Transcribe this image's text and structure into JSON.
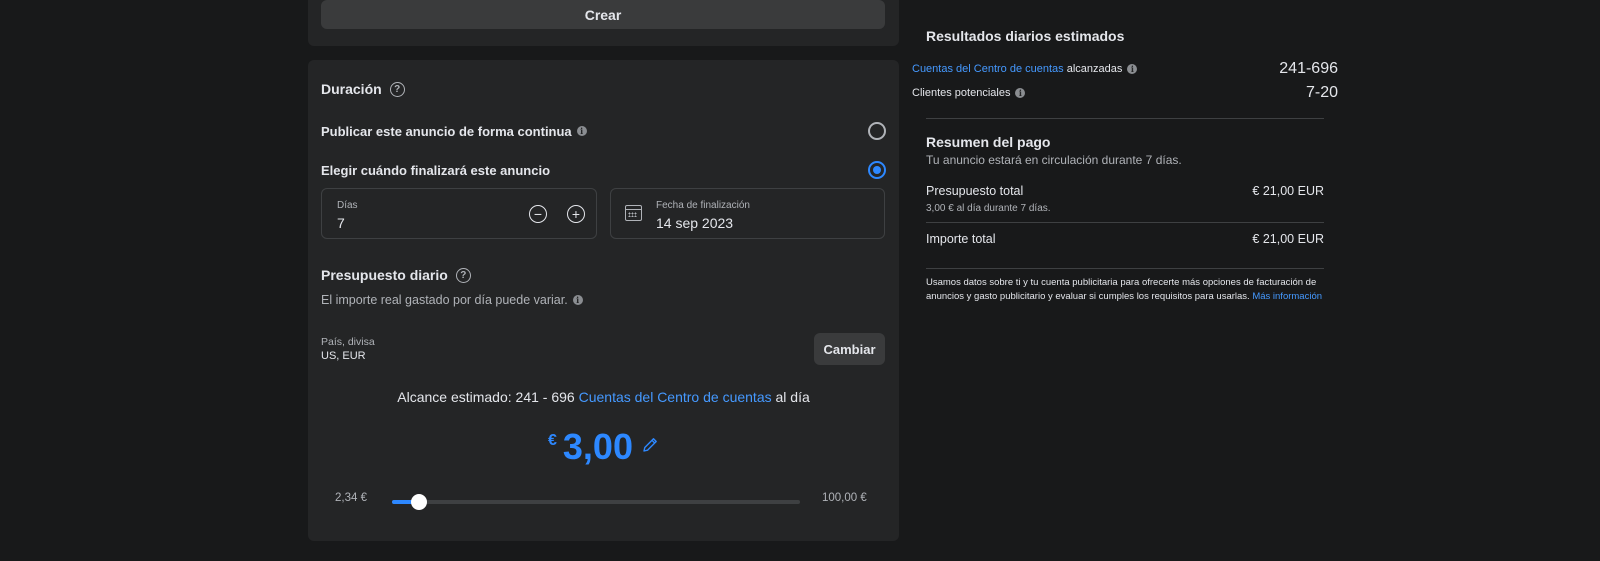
{
  "top": {
    "create_label": "Crear"
  },
  "duration": {
    "title": "Duración",
    "help": "?",
    "continuous_label": "Publicar este anuncio de forma continua",
    "end_label": "Elegir cuándo finalizará este anuncio",
    "selected_option": "end",
    "days_label": "Días",
    "days_value": "7",
    "minus": "−",
    "plus": "+",
    "end_date_label": "Fecha de finalización",
    "end_date_value": "14 sep 2023"
  },
  "budget": {
    "title": "Presupuesto diario",
    "help": "?",
    "subtitle": "El importe real gastado por día puede variar.",
    "country_label": "País, divisa",
    "country_value": "US, EUR",
    "change_label": "Cambiar",
    "reach_prefix": "Alcance estimado: 241 - 696",
    "reach_link": "Cuentas del Centro de cuentas",
    "reach_suffix": "al día",
    "currency_symbol": "€",
    "amount": "3,00",
    "slider_min": "2,34 €",
    "slider_max": "100,00 €",
    "slider_fraction": 0.066
  },
  "results": {
    "title": "Resultados diarios estimados",
    "row1_link": "Cuentas del Centro de cuentas",
    "row1_label": "alcanzadas",
    "row1_value": "241-696",
    "row2_label": "Clientes potenciales",
    "row2_value": "7-20"
  },
  "payment": {
    "title": "Resumen del pago",
    "subtitle": "Tu anuncio estará en circulación durante 7 días.",
    "total_budget_label": "Presupuesto total",
    "total_budget_value": "€ 21,00 EUR",
    "total_budget_detail": "3,00 € al día durante 7 días.",
    "total_amount_label": "Importe total",
    "total_amount_value": "€ 21,00 EUR",
    "note": "Usamos datos sobre ti y tu cuenta publicitaria para ofrecerte más opciones de facturación de anuncios y gasto publicitario y evaluar si cumples los requisitos para usarlas.",
    "note_link": "Más información"
  },
  "colors": {
    "accent": "#2d88ff",
    "link": "#4599ff",
    "card": "#242526",
    "background": "#18191a"
  }
}
